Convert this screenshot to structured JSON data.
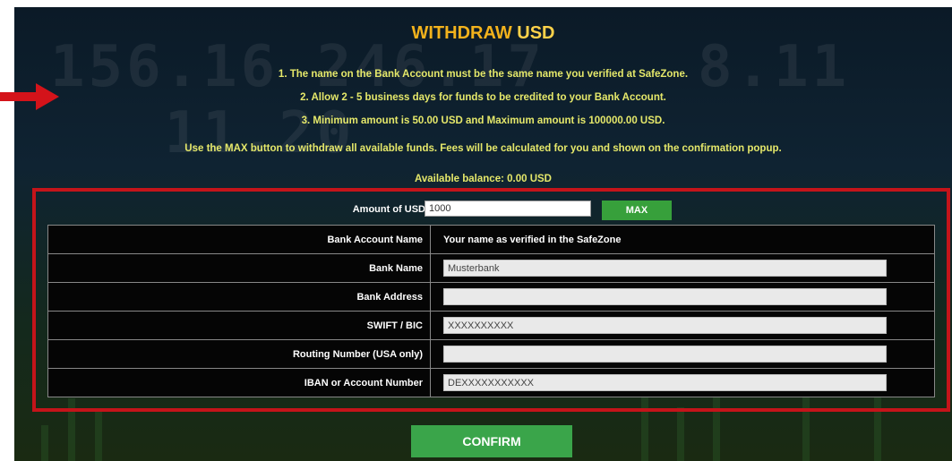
{
  "header": {
    "title_part1": "WITHDRAW",
    "title_part2": "USD"
  },
  "rules": [
    "1. The name on the Bank Account must be the same name you verified at SafeZone.",
    "2. Allow 2 - 5 business days for funds to be credited to your Bank Account.",
    "3. Minimum amount is 50.00 USD and Maximum amount is 100000.00 USD."
  ],
  "note": "Use the MAX button to withdraw all available funds. Fees will be calculated for you and shown on the confirmation popup.",
  "balance": "Available balance: 0.00 USD",
  "amount": {
    "label": "Amount of USD",
    "value": "1000",
    "max_label": "MAX"
  },
  "fields": [
    {
      "label": "Bank Account Name",
      "value": "Your name as verified in the SafeZone",
      "editable": false
    },
    {
      "label": "Bank Name",
      "value": "Musterbank",
      "editable": true
    },
    {
      "label": "Bank Address",
      "value": "",
      "editable": true
    },
    {
      "label": "SWIFT / BIC",
      "value": "XXXXXXXXXX",
      "editable": true
    },
    {
      "label": "Routing Number (USA only)",
      "value": "",
      "editable": true
    },
    {
      "label": "IBAN or Account Number",
      "value": "DEXXXXXXXXXXX",
      "editable": true
    }
  ],
  "confirm_label": "CONFIRM",
  "colors": {
    "title": "#f2b21c",
    "rules_text": "#e5e86a",
    "highlight_border": "#c4141a",
    "annotation_arrow": "#d4131a",
    "button_green": "#3aa54a"
  },
  "icons": {
    "annotation": "right-arrow-icon"
  }
}
